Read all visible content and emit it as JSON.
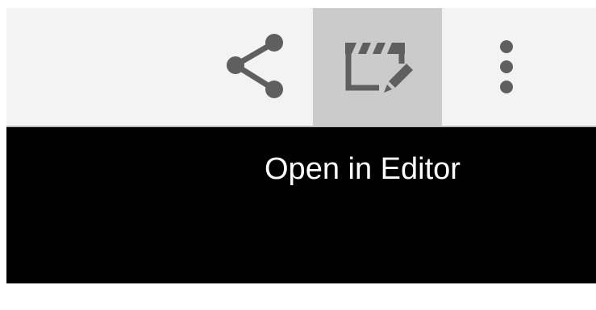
{
  "toolbar": {
    "buttons": [
      {
        "name": "share",
        "icon": "share-icon"
      },
      {
        "name": "open-in-editor",
        "icon": "clapperboard-edit-icon",
        "state": "hovered"
      },
      {
        "name": "more-options",
        "icon": "more-vertical-icon"
      }
    ]
  },
  "tooltip": {
    "text": "Open in Editor"
  },
  "colors": {
    "toolbar_background": "#f3f3f3",
    "hovered_button_background": "#cbcbcb",
    "icon": "#5f5f5f",
    "tooltip_background": "#000000",
    "tooltip_text": "#ffffff"
  }
}
